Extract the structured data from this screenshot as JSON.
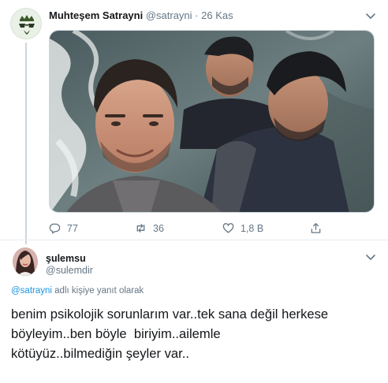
{
  "tweet": {
    "display_name": "Muhteşem Satrayni",
    "handle": "@satrayni",
    "separator": "·",
    "date": "26 Kas",
    "avatar_icon": "crown-glasses-avatar",
    "stats": {
      "replies": "77",
      "retweets": "36",
      "likes": "1,8 B"
    }
  },
  "reply": {
    "display_name": "şulemsu",
    "handle": "@sulemdir",
    "replying_to_mention": "@satrayni",
    "replying_to_suffix": " adlı kişiye yanıt olarak",
    "text_lines": [
      "benim psikolojik sorunlarım var..tek sana değil herkese",
      "böyleyim..ben böyle  biriyim..ailemle",
      "kötüyüz..bilmediğin şeyler var.."
    ]
  },
  "colors": {
    "link": "#1b95e0",
    "secondary_text": "#657786",
    "primary_text": "#14171a",
    "border": "#e6ecf0"
  }
}
